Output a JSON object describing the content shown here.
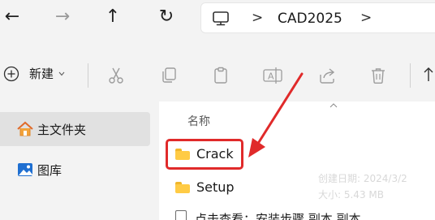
{
  "nav": {
    "back_glyph": "←",
    "forward_glyph": "→",
    "up_glyph": "↑",
    "refresh_glyph": "↻",
    "chevron": ">"
  },
  "address": {
    "segments": [
      "CAD2025"
    ]
  },
  "toolbar": {
    "new_label": "新建",
    "new_glyph": "+"
  },
  "sidebar": {
    "items": [
      {
        "label": "主文件夹",
        "icon": "home-icon",
        "selected": true
      },
      {
        "label": "图库",
        "icon": "gallery-icon",
        "selected": false
      }
    ]
  },
  "content": {
    "column_name": "名称",
    "files": [
      {
        "name": "Crack",
        "type": "folder",
        "highlighted": true
      },
      {
        "name": "Setup",
        "type": "folder",
        "highlighted": false
      },
      {
        "name": "点击查看：安装步骤  副本   副本",
        "type": "file",
        "highlighted": false
      }
    ],
    "tooltip_lines": [
      "创建日期: 2024/3/2",
      "大小: 5.43 MB"
    ]
  },
  "colors": {
    "accent_red": "#e02a2a",
    "folder_yellow": "#ffcb45",
    "selection": "#e1e1e1"
  }
}
